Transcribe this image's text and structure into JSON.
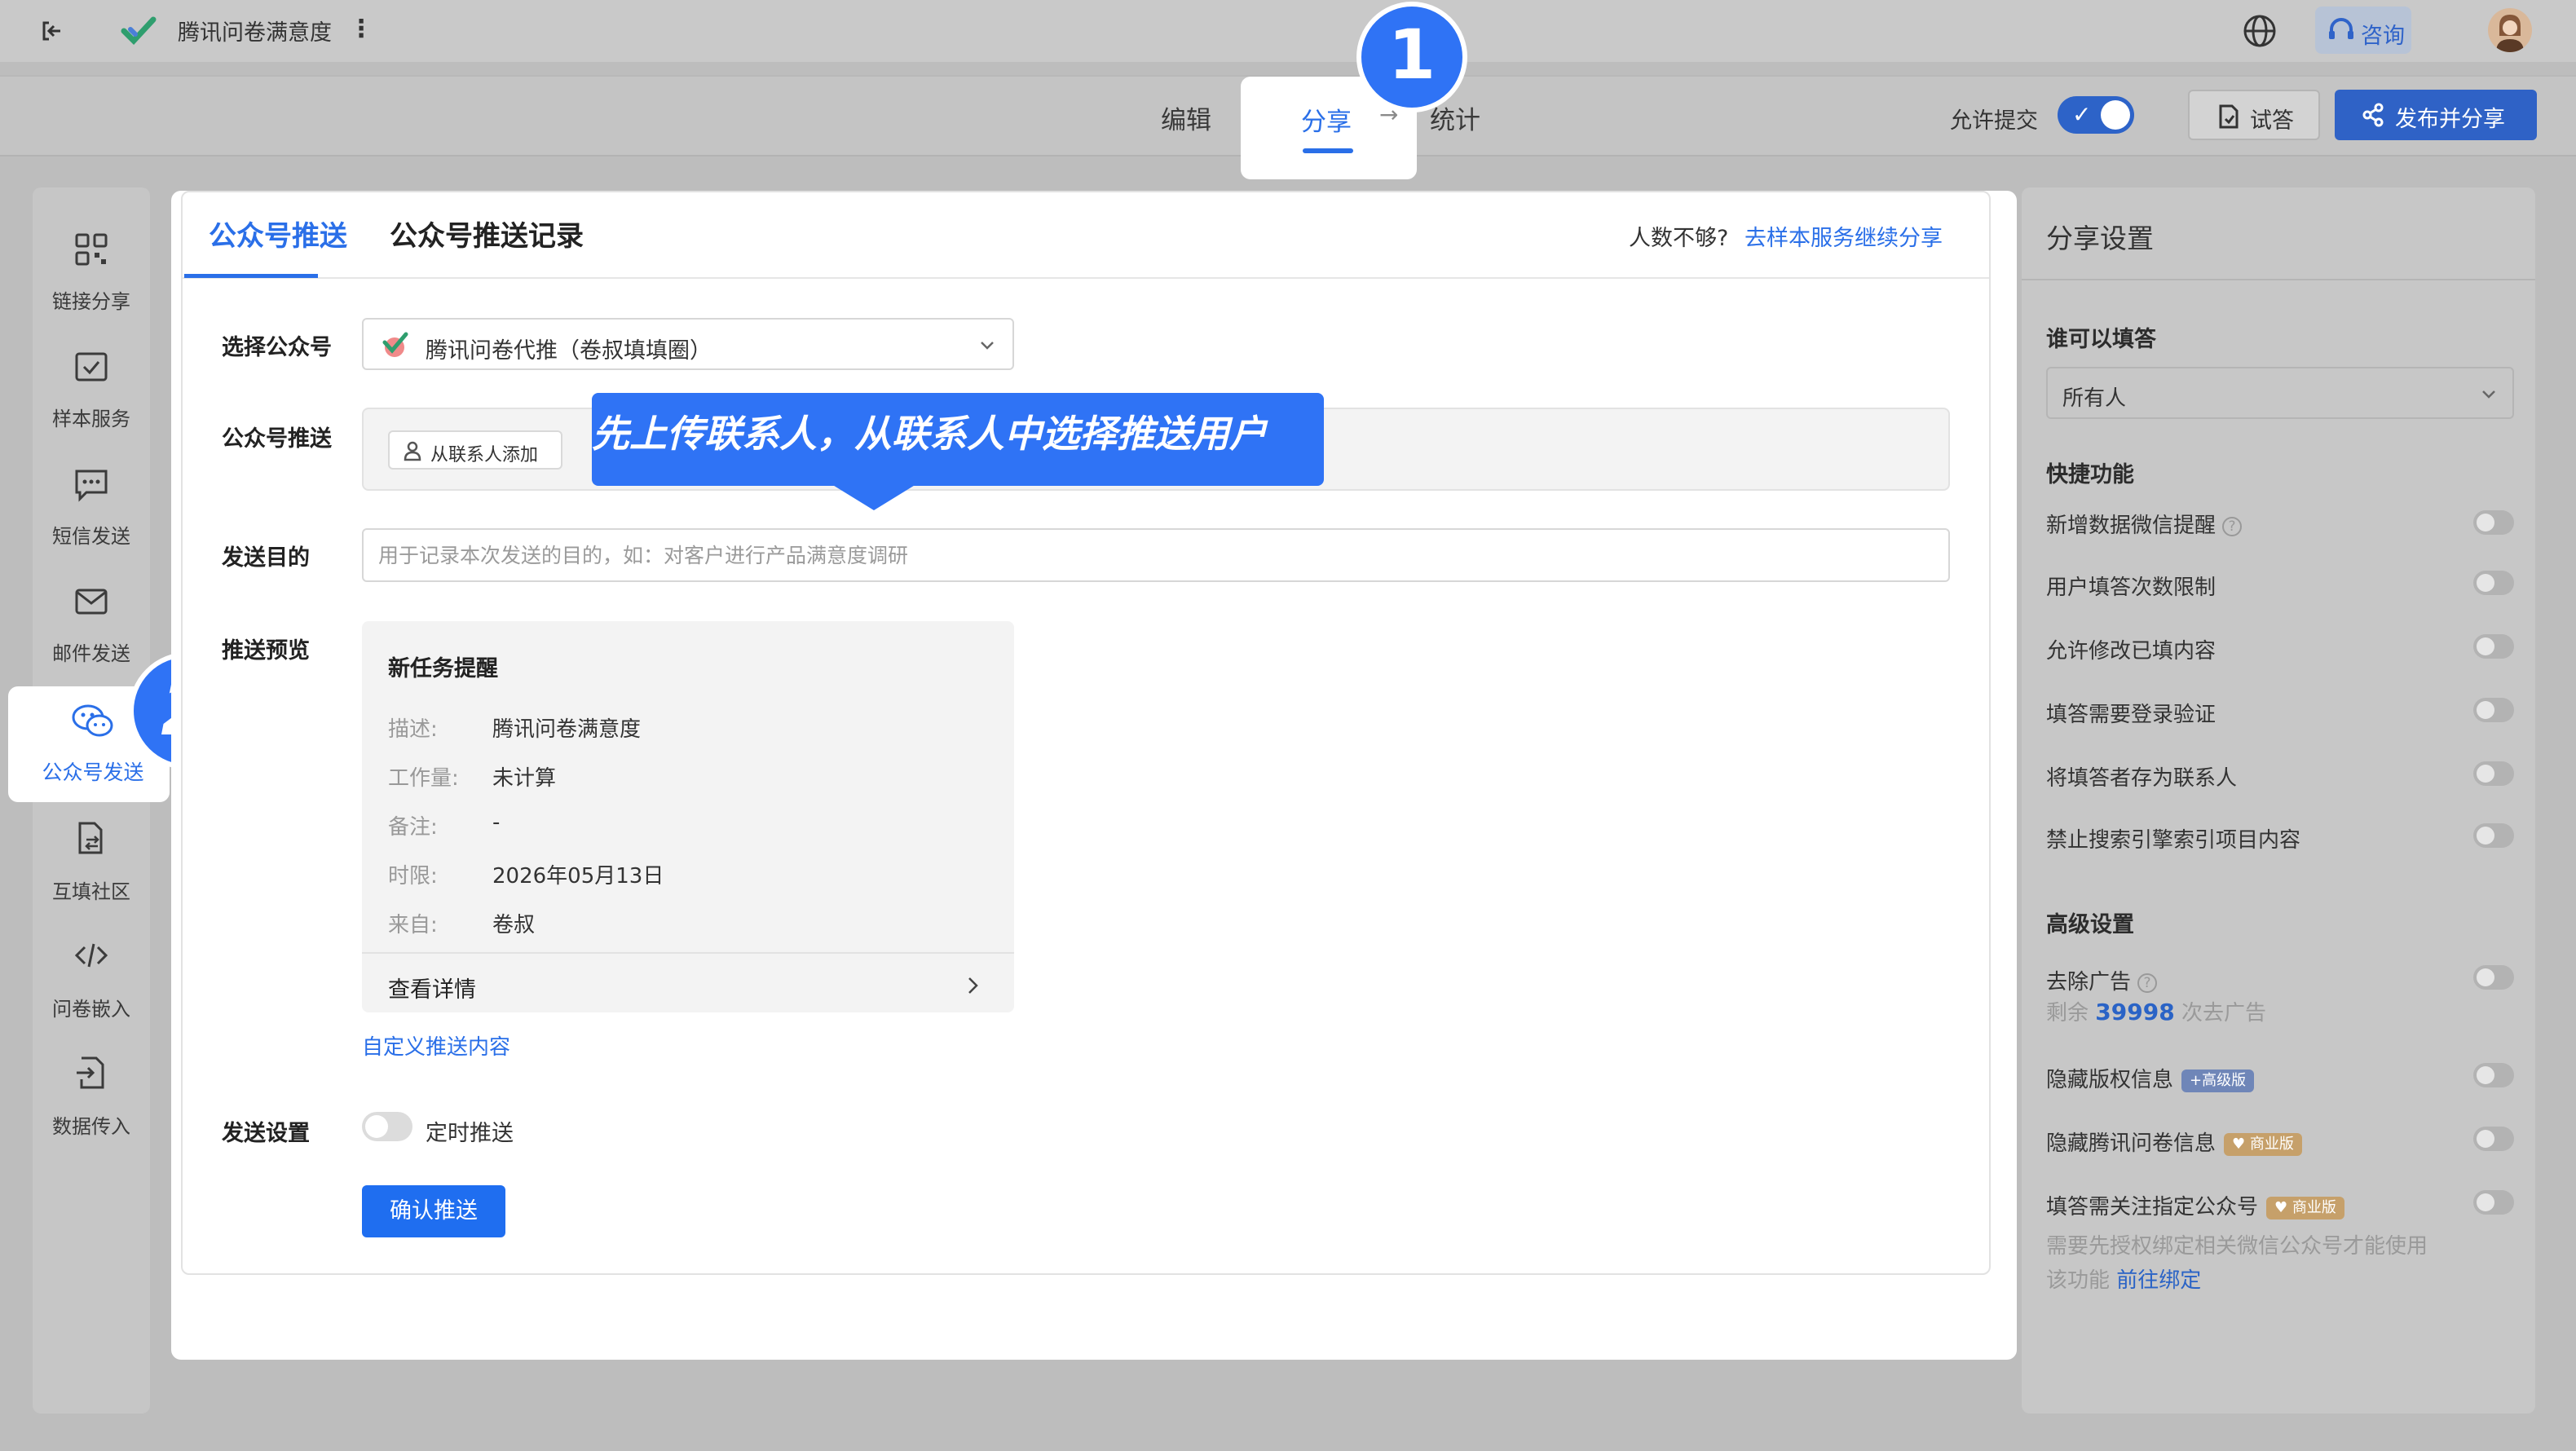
{
  "topbar": {
    "title": "腾讯问卷满意度",
    "consult_label": "咨询"
  },
  "steps": {
    "edit": "编辑",
    "share": "分享",
    "stats": "统计",
    "badge_number": "1"
  },
  "toolbar": {
    "allow_submit_label": "允许提交",
    "allow_submit_on": true,
    "try_label": "试答",
    "publish_label": "发布并分享"
  },
  "sidebar": {
    "items": [
      {
        "label": "链接分享",
        "icon": "qr-grid-icon"
      },
      {
        "label": "样本服务",
        "icon": "checkbox-icon"
      },
      {
        "label": "短信发送",
        "icon": "sms-bubble-icon"
      },
      {
        "label": "邮件发送",
        "icon": "mail-icon"
      },
      {
        "label": "公众号发送",
        "icon": "wechat-icon",
        "active": true
      },
      {
        "label": "互填社区",
        "icon": "file-swap-icon"
      },
      {
        "label": "问卷嵌入",
        "icon": "code-icon"
      },
      {
        "label": "数据传入",
        "icon": "file-import-icon"
      }
    ],
    "badge_number": "2"
  },
  "main": {
    "tabs": [
      {
        "label": "公众号推送",
        "active": true
      },
      {
        "label": "公众号推送记录",
        "active": false
      }
    ],
    "not_enough_text": "人数不够?",
    "goto_sample_link": "去样本服务继续分享",
    "select_account_label": "选择公众号",
    "selected_account": "腾讯问卷代推（卷叔填填圈）",
    "push_label": "公众号推送",
    "add_contact_label": "从联系人添加",
    "tooltip_text": "先上传联系人，从联系人中选择推送用户",
    "purpose_label": "发送目的",
    "purpose_placeholder": "用于记录本次发送的目的，如：对客户进行产品满意度调研",
    "preview_label": "推送预览",
    "preview": {
      "title": "新任务提醒",
      "rows": [
        {
          "key": "描述:",
          "value": "腾讯问卷满意度"
        },
        {
          "key": "工作量:",
          "value": "未计算"
        },
        {
          "key": "备注:",
          "value": "-"
        },
        {
          "key": "时限:",
          "value": "2026年05月13日"
        },
        {
          "key": "来自:",
          "value": "卷叔"
        }
      ],
      "detail_label": "查看详情"
    },
    "custom_push_link": "自定义推送内容",
    "send_settings_label": "发送设置",
    "timed_push_label": "定时推送",
    "timed_push_on": false,
    "confirm_label": "确认推送"
  },
  "right_panel": {
    "title": "分享设置",
    "who_can_fill_label": "谁可以填答",
    "who_can_fill_value": "所有人",
    "quick_section": "快捷功能",
    "quick_items": [
      {
        "label": "新增数据微信提醒",
        "help": true,
        "on": false
      },
      {
        "label": "用户填答次数限制",
        "on": false
      },
      {
        "label": "允许修改已填内容",
        "on": false
      },
      {
        "label": "填答需要登录验证",
        "on": false
      },
      {
        "label": "将填答者存为联系人",
        "on": false
      },
      {
        "label": "禁止搜索引擎索引项目内容",
        "on": false
      }
    ],
    "advanced_section": "高级设置",
    "remove_ads_label": "去除广告",
    "remaining_prefix": "剩余",
    "remaining_count": "39998",
    "remaining_suffix": "次去广告",
    "hide_copyright_label": "隐藏版权信息",
    "hide_copyright_badge": "+高级版",
    "hide_tencent_label": "隐藏腾讯问卷信息",
    "hide_tencent_badge": "♥ 商业版",
    "follow_account_label": "填答需关注指定公众号",
    "follow_account_badge": "♥ 商业版",
    "follow_note_line1": "需要先授权绑定相关微信公众号才能使用",
    "follow_note_line2": "该功能",
    "bind_link": "前往绑定"
  },
  "colors": {
    "accent": "#2a6fe8",
    "badge": "#2f73f5",
    "overlay_gray": "#c6c6c6"
  }
}
